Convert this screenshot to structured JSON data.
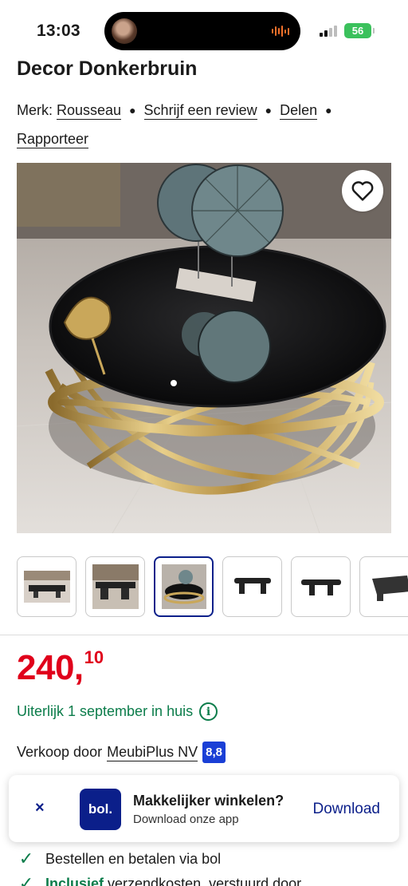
{
  "status_bar": {
    "time": "13:03",
    "battery": "56"
  },
  "product": {
    "title": "Decor Donkerbruin",
    "brand_label": "Merk:",
    "brand": "Rousseau",
    "write_review": "Schrijf een review",
    "share": "Delen",
    "report": "Rapporteer"
  },
  "pricing": {
    "whole": "240,",
    "cents": "10"
  },
  "delivery": {
    "text": "Uiterlijk 1 september in huis",
    "info_icon": "i"
  },
  "seller": {
    "label": "Verkoop door",
    "name": "MeubiPlus NV",
    "score": "8,8"
  },
  "app_banner": {
    "close": "×",
    "logo": "bol.",
    "title": "Makkelijker winkelen?",
    "subtitle": "Download onze app",
    "button": "Download"
  },
  "usps": [
    {
      "bold": "",
      "text": "Bestellen en betalen via bol"
    },
    {
      "bold": "Inclusief",
      "text": " verzendkosten, verstuurd door"
    }
  ],
  "colors": {
    "price": "#e0001b",
    "brand_blue": "#0b1f8a",
    "success_green": "#0b7c4a",
    "score_blue": "#1a3fd6"
  },
  "icons": [
    "heart-icon",
    "info-icon",
    "close-icon",
    "check-icon"
  ]
}
